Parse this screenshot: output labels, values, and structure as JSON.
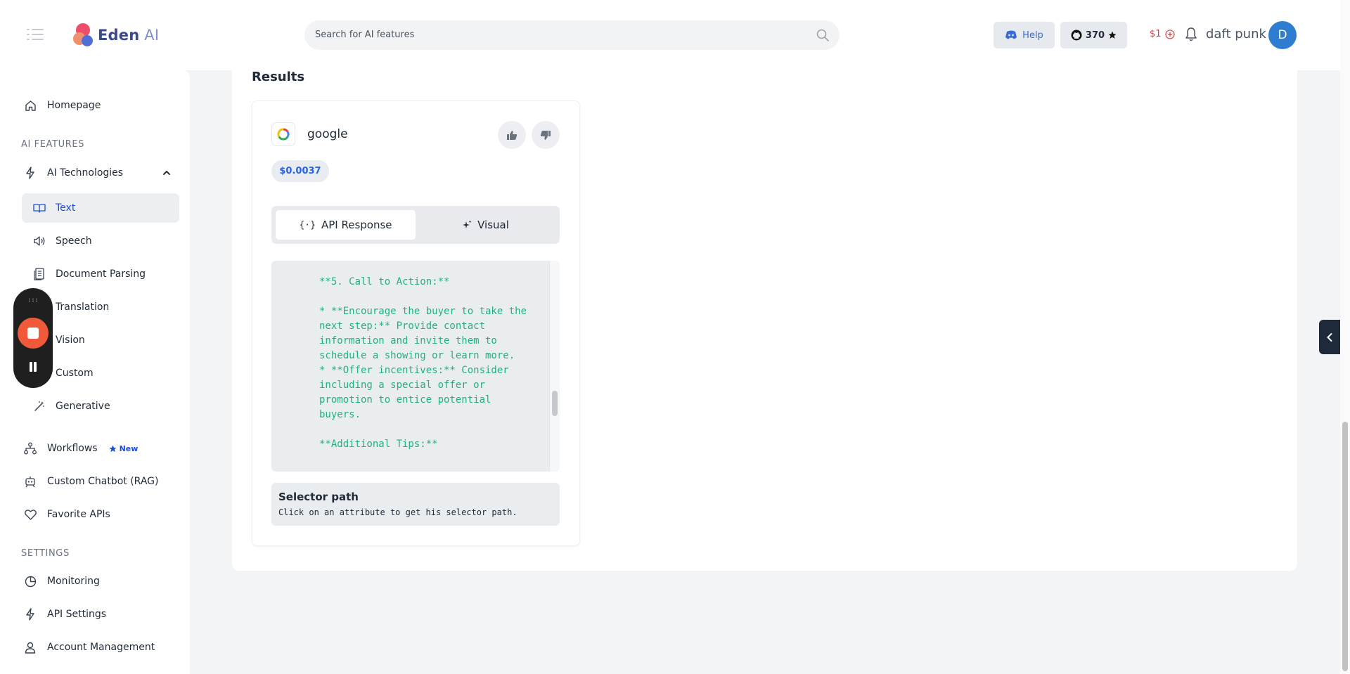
{
  "header": {
    "logo_text_1": "Eden",
    "logo_text_2": "AI",
    "search_placeholder": "Search for AI features",
    "help_label": "Help",
    "github_stars": "370",
    "credit": "$1",
    "username": "daft punk",
    "avatar_initial": "D"
  },
  "sidebar": {
    "homepage": "Homepage",
    "ai_features_title": "AI FEATURES",
    "ai_technologies": "AI Technologies",
    "sub_items": [
      "Text",
      "Speech",
      "Document Parsing",
      "Translation",
      "Vision",
      "Custom",
      "Generative"
    ],
    "active_sub_item": "Text",
    "workflows": "Workflows",
    "workflows_badge": "New",
    "custom_chatbot": "Custom Chatbot (RAG)",
    "favorite_apis": "Favorite APIs",
    "settings_title": "SETTINGS",
    "monitoring": "Monitoring",
    "api_settings": "API Settings",
    "account_management": "Account Management"
  },
  "results": {
    "title": "Results",
    "provider": "google",
    "price": "$0.0037",
    "tabs": [
      "API Response",
      "Visual"
    ],
    "active_tab": "API Response",
    "code_lines": [
      "**5. Call to Action:**",
      "",
      "* **Encourage the buyer to take the",
      "next step:** Provide contact",
      "information and invite them to",
      "schedule a showing or learn more.",
      "* **Offer incentives:** Consider",
      "including a special offer or",
      "promotion to entice potential",
      "buyers.",
      "",
      "**Additional Tips:**"
    ],
    "selector_title": "Selector path",
    "selector_desc": "Click on an attribute to get his selector path."
  },
  "colors": {
    "accent_blue": "#2563eb",
    "code_green": "#22b07d",
    "record_red": "#f05a3a",
    "credit_red": "#e23b3b"
  }
}
